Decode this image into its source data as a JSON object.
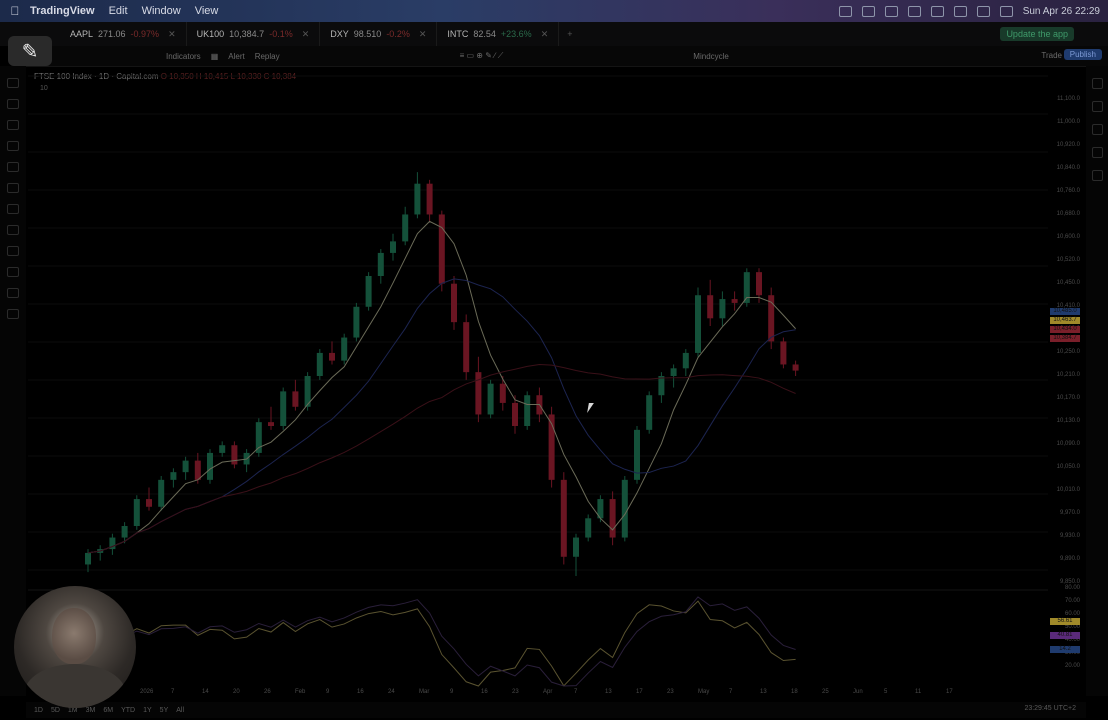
{
  "menubar": {
    "app": "TradingView",
    "items": [
      "Edit",
      "Window",
      "View"
    ],
    "datetime": "Sun Apr 26  22:29"
  },
  "tabs": [
    {
      "symbol": "AAPL",
      "price": "271.06",
      "change": "-0.97%"
    },
    {
      "symbol": "UK100",
      "price": "10,384.7",
      "change": "-0.1%"
    },
    {
      "symbol": "DXY",
      "price": "98.510",
      "change": "-0.2%"
    },
    {
      "symbol": "INTC",
      "price": "82.54",
      "change": "+23.6%"
    }
  ],
  "update_button": "Update the app",
  "toolbar": {
    "indicators": "Indicators",
    "alert": "Alert",
    "replay": "Replay",
    "layout_name": "Mindcycle",
    "trade": "Trade",
    "publish": "Publish"
  },
  "legend": {
    "title": "FTSE 100 Index · 1D · Capital.com",
    "values": "O 10,350  H 10,415  L 10,330  C 10,384",
    "volume": "10"
  },
  "chart_data": {
    "type": "candlestick",
    "instrument": "FTSE 100 Index",
    "interval": "1D",
    "price_ticks": [
      "11,100.0",
      "11,000.0",
      "10,920.0",
      "10,840.0",
      "10,760.0",
      "10,680.0",
      "10,600.0",
      "10,520.0",
      "10,450.0",
      "10,410.0",
      "10,330.0",
      "10,250.0",
      "10,210.0",
      "10,170.0",
      "10,130.0",
      "10,090.0",
      "10,050.0",
      "10,010.0",
      "9,970.0",
      "9,930.0",
      "9,890.0",
      "9,850.0"
    ],
    "time_labels": [
      "2026",
      "7",
      "14",
      "20",
      "26",
      "Feb",
      "9",
      "16",
      "24",
      "Mar",
      "9",
      "16",
      "23",
      "Apr",
      "7",
      "13",
      "17",
      "23",
      "May",
      "7",
      "13",
      "18",
      "25",
      "Jun",
      "5",
      "11",
      "17"
    ],
    "price_tags": [
      {
        "label": "10,485.0",
        "color": "#1f3b6e"
      },
      {
        "label": "10,463.7",
        "color": "#a08a2a"
      },
      {
        "label": "10,434.0",
        "color": "#7a1f2a"
      },
      {
        "label": "10,384.7",
        "color": "#7a1f2a"
      }
    ],
    "oscillator_ticks": [
      "80.00",
      "70.00",
      "60.00",
      "50.00",
      "40.00",
      "30.00",
      "20.00"
    ],
    "oscillator_tags": [
      {
        "label": "56.61",
        "color": "#a08a2a"
      },
      {
        "label": "40.81",
        "color": "#5a2a7a"
      },
      {
        "label": "14.2",
        "color": "#1f3b6e"
      }
    ],
    "candles": [
      {
        "o": 9880,
        "h": 9920,
        "l": 9860,
        "c": 9910
      },
      {
        "o": 9910,
        "h": 9930,
        "l": 9890,
        "c": 9920
      },
      {
        "o": 9920,
        "h": 9960,
        "l": 9905,
        "c": 9950
      },
      {
        "o": 9950,
        "h": 9990,
        "l": 9935,
        "c": 9980
      },
      {
        "o": 9980,
        "h": 10060,
        "l": 9970,
        "c": 10050
      },
      {
        "o": 10050,
        "h": 10080,
        "l": 10020,
        "c": 10030
      },
      {
        "o": 10030,
        "h": 10110,
        "l": 10020,
        "c": 10100
      },
      {
        "o": 10100,
        "h": 10130,
        "l": 10080,
        "c": 10120
      },
      {
        "o": 10120,
        "h": 10160,
        "l": 10100,
        "c": 10150
      },
      {
        "o": 10150,
        "h": 10170,
        "l": 10090,
        "c": 10100
      },
      {
        "o": 10100,
        "h": 10180,
        "l": 10090,
        "c": 10170
      },
      {
        "o": 10170,
        "h": 10200,
        "l": 10160,
        "c": 10190
      },
      {
        "o": 10190,
        "h": 10200,
        "l": 10130,
        "c": 10140
      },
      {
        "o": 10140,
        "h": 10180,
        "l": 10120,
        "c": 10170
      },
      {
        "o": 10170,
        "h": 10260,
        "l": 10160,
        "c": 10250
      },
      {
        "o": 10250,
        "h": 10290,
        "l": 10230,
        "c": 10240
      },
      {
        "o": 10240,
        "h": 10340,
        "l": 10230,
        "c": 10330
      },
      {
        "o": 10330,
        "h": 10360,
        "l": 10280,
        "c": 10290
      },
      {
        "o": 10290,
        "h": 10380,
        "l": 10280,
        "c": 10370
      },
      {
        "o": 10370,
        "h": 10440,
        "l": 10360,
        "c": 10430
      },
      {
        "o": 10430,
        "h": 10460,
        "l": 10400,
        "c": 10410
      },
      {
        "o": 10410,
        "h": 10480,
        "l": 10400,
        "c": 10470
      },
      {
        "o": 10470,
        "h": 10560,
        "l": 10460,
        "c": 10550
      },
      {
        "o": 10550,
        "h": 10640,
        "l": 10540,
        "c": 10630
      },
      {
        "o": 10630,
        "h": 10700,
        "l": 10610,
        "c": 10690
      },
      {
        "o": 10690,
        "h": 10740,
        "l": 10670,
        "c": 10720
      },
      {
        "o": 10720,
        "h": 10810,
        "l": 10710,
        "c": 10790
      },
      {
        "o": 10790,
        "h": 10900,
        "l": 10780,
        "c": 10870
      },
      {
        "o": 10870,
        "h": 10880,
        "l": 10770,
        "c": 10790
      },
      {
        "o": 10790,
        "h": 10800,
        "l": 10590,
        "c": 10610
      },
      {
        "o": 10610,
        "h": 10630,
        "l": 10490,
        "c": 10510
      },
      {
        "o": 10510,
        "h": 10530,
        "l": 10360,
        "c": 10380
      },
      {
        "o": 10380,
        "h": 10420,
        "l": 10250,
        "c": 10270
      },
      {
        "o": 10270,
        "h": 10360,
        "l": 10260,
        "c": 10350
      },
      {
        "o": 10350,
        "h": 10370,
        "l": 10280,
        "c": 10300
      },
      {
        "o": 10300,
        "h": 10320,
        "l": 10220,
        "c": 10240
      },
      {
        "o": 10240,
        "h": 10330,
        "l": 10230,
        "c": 10320
      },
      {
        "o": 10320,
        "h": 10340,
        "l": 10250,
        "c": 10270
      },
      {
        "o": 10270,
        "h": 10290,
        "l": 10080,
        "c": 10100
      },
      {
        "o": 10100,
        "h": 10120,
        "l": 9880,
        "c": 9900
      },
      {
        "o": 9900,
        "h": 9960,
        "l": 9850,
        "c": 9950
      },
      {
        "o": 9950,
        "h": 10010,
        "l": 9940,
        "c": 10000
      },
      {
        "o": 10000,
        "h": 10060,
        "l": 9990,
        "c": 10050
      },
      {
        "o": 10050,
        "h": 10070,
        "l": 9930,
        "c": 9950
      },
      {
        "o": 9950,
        "h": 10110,
        "l": 9940,
        "c": 10100
      },
      {
        "o": 10100,
        "h": 10240,
        "l": 10090,
        "c": 10230
      },
      {
        "o": 10230,
        "h": 10330,
        "l": 10220,
        "c": 10320
      },
      {
        "o": 10320,
        "h": 10380,
        "l": 10300,
        "c": 10370
      },
      {
        "o": 10370,
        "h": 10400,
        "l": 10340,
        "c": 10390
      },
      {
        "o": 10390,
        "h": 10440,
        "l": 10370,
        "c": 10430
      },
      {
        "o": 10430,
        "h": 10600,
        "l": 10420,
        "c": 10580
      },
      {
        "o": 10580,
        "h": 10620,
        "l": 10500,
        "c": 10520
      },
      {
        "o": 10520,
        "h": 10590,
        "l": 10500,
        "c": 10570
      },
      {
        "o": 10570,
        "h": 10590,
        "l": 10540,
        "c": 10560
      },
      {
        "o": 10560,
        "h": 10650,
        "l": 10550,
        "c": 10640
      },
      {
        "o": 10640,
        "h": 10650,
        "l": 10560,
        "c": 10580
      },
      {
        "o": 10580,
        "h": 10600,
        "l": 10440,
        "c": 10460
      },
      {
        "o": 10460,
        "h": 10470,
        "l": 10390,
        "c": 10400
      },
      {
        "o": 10400,
        "h": 10410,
        "l": 10370,
        "c": 10384
      }
    ]
  }
}
